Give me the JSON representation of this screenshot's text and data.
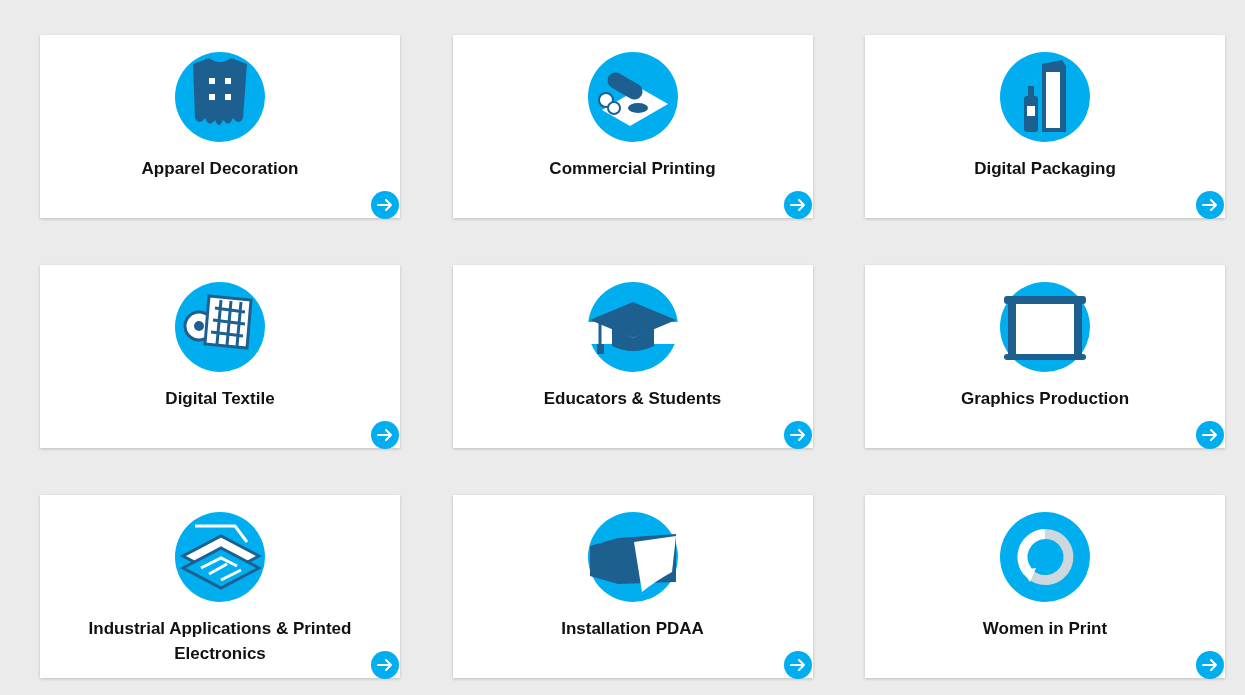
{
  "cards": [
    {
      "title": "Apparel Decoration"
    },
    {
      "title": "Commercial Printing"
    },
    {
      "title": "Digital Packaging"
    },
    {
      "title": "Digital Textile"
    },
    {
      "title": "Educators & Students"
    },
    {
      "title": "Graphics Production"
    },
    {
      "title": "Industrial Applications & Printed Electronics"
    },
    {
      "title": "Installation PDAA"
    },
    {
      "title": "Women in Print"
    }
  ]
}
